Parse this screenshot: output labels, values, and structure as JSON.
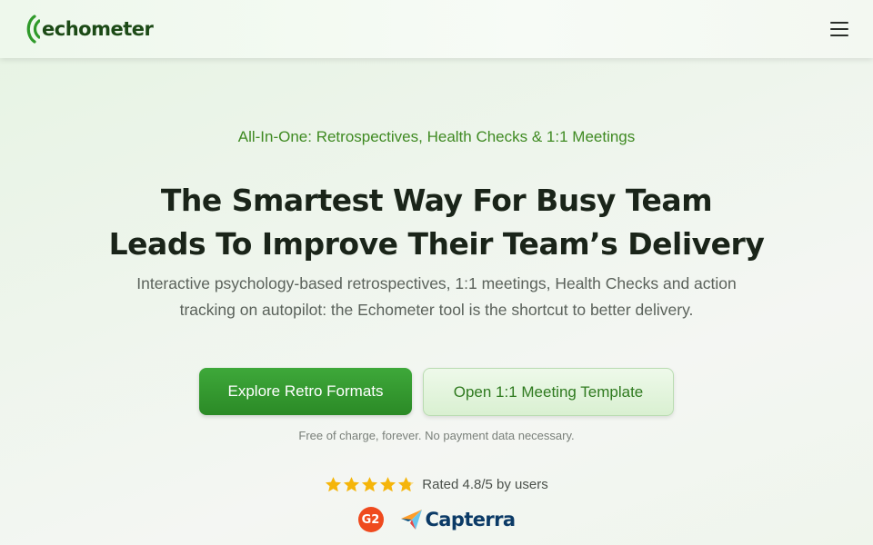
{
  "header": {
    "logo_text": "echometer",
    "menu_icon": "hamburger-icon"
  },
  "hero": {
    "tagline": "All-In-One: Retrospectives, Health Checks & 1:1 Meetings",
    "headline_line1": "The Smartest Way For Busy Team",
    "headline_line2": "Leads To Improve Their Team’s Delivery",
    "subtext": "Interactive psychology-based retrospectives, 1:1 meetings, Health Checks and action tracking on autopilot: the Echometer tool is the shortcut to better delivery.",
    "primary_button": "Explore Retro Formats",
    "secondary_button": "Open 1:1 Meeting Template",
    "note": "Free of charge, forever. No payment data necessary."
  },
  "rating": {
    "stars": 4.8,
    "max_stars": 5,
    "text": "Rated 4.8/5 by users"
  },
  "badges": {
    "g2_label": "G2",
    "capterra_label": "Capterra"
  },
  "colors": {
    "brand_green": "#2b8a26",
    "tagline_green": "#3f8a22",
    "star_yellow": "#f5b50a",
    "g2_orange": "#ef4a1e",
    "capterra_navy": "#0b3a66"
  }
}
